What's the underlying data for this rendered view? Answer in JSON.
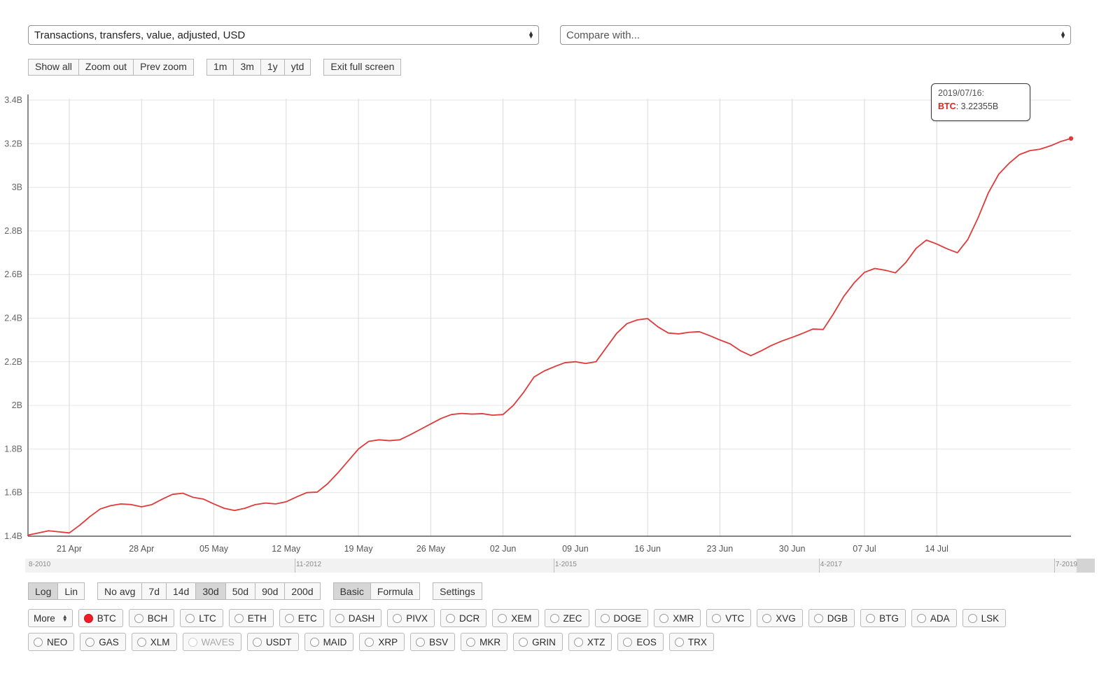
{
  "metric_select": {
    "value": "Transactions, transfers, value, adjusted, USD"
  },
  "compare_select": {
    "value": "Compare with..."
  },
  "range_buttons": {
    "zoom_group": [
      "Show all",
      "Zoom out",
      "Prev zoom"
    ],
    "period_group": [
      "1m",
      "3m",
      "1y",
      "ytd"
    ],
    "fullscreen": "Exit full screen"
  },
  "bottom_controls": {
    "scale_group": [
      "Log",
      "Lin"
    ],
    "scale_active": "Log",
    "avg_group": [
      "No avg",
      "7d",
      "14d",
      "30d",
      "50d",
      "90d",
      "200d"
    ],
    "avg_active": "30d",
    "mode_group": [
      "Basic",
      "Formula"
    ],
    "mode_active": "Basic",
    "settings": "Settings"
  },
  "coins": {
    "more_label": "More",
    "row1": [
      {
        "label": "BTC",
        "state": "on"
      },
      {
        "label": "BCH",
        "state": "off"
      },
      {
        "label": "LTC",
        "state": "off"
      },
      {
        "label": "ETH",
        "state": "off"
      },
      {
        "label": "ETC",
        "state": "off"
      },
      {
        "label": "DASH",
        "state": "off"
      },
      {
        "label": "PIVX",
        "state": "off"
      },
      {
        "label": "DCR",
        "state": "off"
      },
      {
        "label": "XEM",
        "state": "off"
      },
      {
        "label": "ZEC",
        "state": "off"
      },
      {
        "label": "DOGE",
        "state": "off"
      },
      {
        "label": "XMR",
        "state": "off"
      },
      {
        "label": "VTC",
        "state": "off"
      },
      {
        "label": "XVG",
        "state": "off"
      },
      {
        "label": "DGB",
        "state": "off"
      },
      {
        "label": "BTG",
        "state": "off"
      },
      {
        "label": "ADA",
        "state": "off"
      },
      {
        "label": "LSK",
        "state": "off"
      }
    ],
    "row2": [
      {
        "label": "NEO",
        "state": "off"
      },
      {
        "label": "GAS",
        "state": "off"
      },
      {
        "label": "XLM",
        "state": "off"
      },
      {
        "label": "WAVES",
        "state": "dim"
      },
      {
        "label": "USDT",
        "state": "off"
      },
      {
        "label": "MAID",
        "state": "off"
      },
      {
        "label": "XRP",
        "state": "off"
      },
      {
        "label": "BSV",
        "state": "off"
      },
      {
        "label": "MKR",
        "state": "off"
      },
      {
        "label": "GRIN",
        "state": "off"
      },
      {
        "label": "XTZ",
        "state": "off"
      },
      {
        "label": "EOS",
        "state": "off"
      },
      {
        "label": "TRX",
        "state": "off"
      }
    ]
  },
  "tooltip": {
    "date": "2019/07/16:",
    "symbol": "BTC",
    "value": ": 3.22355B"
  },
  "navigator": {
    "labels": [
      "8-2010",
      "11-2012",
      "1-2015",
      "4-2017",
      "7-2019"
    ],
    "label_positions_pct": [
      0.2,
      25.2,
      49.4,
      74.2,
      96.2
    ]
  },
  "chart_data": {
    "type": "line",
    "title": "Transactions, transfers, value, adjusted, USD",
    "xlabel": "",
    "ylabel": "",
    "series_name": "BTC",
    "series_color": "#e03a3a",
    "ylim": [
      1.4,
      3.4
    ],
    "y_ticks": [
      "1.4B",
      "1.6B",
      "1.8B",
      "2B",
      "2.2B",
      "2.4B",
      "2.6B",
      "2.8B",
      "3B",
      "3.2B",
      "3.4B"
    ],
    "y_tick_values": [
      1.4,
      1.6,
      1.8,
      2.0,
      2.2,
      2.4,
      2.6,
      2.8,
      3.0,
      3.2,
      3.4
    ],
    "x_ticks": [
      "21 Apr",
      "28 Apr",
      "05 May",
      "12 May",
      "19 May",
      "26 May",
      "02 Jun",
      "09 Jun",
      "16 Jun",
      "23 Jun",
      "30 Jun",
      "07 Jul",
      "14 Jul"
    ],
    "grid": true,
    "legend": "none",
    "units": "B (billions USD)",
    "x": [
      "2019-04-17",
      "2019-04-18",
      "2019-04-19",
      "2019-04-20",
      "2019-04-21",
      "2019-04-22",
      "2019-04-23",
      "2019-04-24",
      "2019-04-25",
      "2019-04-26",
      "2019-04-27",
      "2019-04-28",
      "2019-04-29",
      "2019-04-30",
      "2019-05-01",
      "2019-05-02",
      "2019-05-03",
      "2019-05-04",
      "2019-05-05",
      "2019-05-06",
      "2019-05-07",
      "2019-05-08",
      "2019-05-09",
      "2019-05-10",
      "2019-05-11",
      "2019-05-12",
      "2019-05-13",
      "2019-05-14",
      "2019-05-15",
      "2019-05-16",
      "2019-05-17",
      "2019-05-18",
      "2019-05-19",
      "2019-05-20",
      "2019-05-21",
      "2019-05-22",
      "2019-05-23",
      "2019-05-24",
      "2019-05-25",
      "2019-05-26",
      "2019-05-27",
      "2019-05-28",
      "2019-05-29",
      "2019-05-30",
      "2019-05-31",
      "2019-06-01",
      "2019-06-02",
      "2019-06-03",
      "2019-06-04",
      "2019-06-05",
      "2019-06-06",
      "2019-06-07",
      "2019-06-08",
      "2019-06-09",
      "2019-06-10",
      "2019-06-11",
      "2019-06-12",
      "2019-06-13",
      "2019-06-14",
      "2019-06-15",
      "2019-06-16",
      "2019-06-17",
      "2019-06-18",
      "2019-06-19",
      "2019-06-20",
      "2019-06-21",
      "2019-06-22",
      "2019-06-23",
      "2019-06-24",
      "2019-06-25",
      "2019-06-26",
      "2019-06-27",
      "2019-06-28",
      "2019-06-29",
      "2019-06-30",
      "2019-07-01",
      "2019-07-02",
      "2019-07-03",
      "2019-07-04",
      "2019-07-05",
      "2019-07-06",
      "2019-07-07",
      "2019-07-08",
      "2019-07-09",
      "2019-07-10",
      "2019-07-11",
      "2019-07-12",
      "2019-07-13",
      "2019-07-14",
      "2019-07-15",
      "2019-07-16"
    ],
    "values": [
      1.405,
      1.415,
      1.425,
      1.42,
      1.415,
      1.45,
      1.49,
      1.525,
      1.54,
      1.548,
      1.545,
      1.535,
      1.545,
      1.57,
      1.592,
      1.597,
      1.578,
      1.57,
      1.548,
      1.528,
      1.518,
      1.528,
      1.545,
      1.552,
      1.548,
      1.558,
      1.58,
      1.6,
      1.602,
      1.64,
      1.69,
      1.745,
      1.8,
      1.835,
      1.842,
      1.838,
      1.842,
      1.865,
      1.89,
      1.915,
      1.94,
      1.958,
      1.963,
      1.96,
      1.962,
      1.955,
      1.958,
      2.0,
      2.06,
      2.13,
      2.158,
      2.178,
      2.196,
      2.2,
      2.192,
      2.2,
      2.265,
      2.33,
      2.375,
      2.392,
      2.398,
      2.36,
      2.332,
      2.328,
      2.335,
      2.338,
      2.32,
      2.3,
      2.282,
      2.25,
      2.228,
      2.25,
      2.275,
      2.295,
      2.312,
      2.33,
      2.35,
      2.348,
      2.42,
      2.5,
      2.562,
      2.61,
      2.628,
      2.62,
      2.608,
      2.655,
      2.72,
      2.758,
      2.74,
      2.718,
      2.7
    ],
    "values_tail": [
      2.76,
      2.86,
      2.975,
      3.06,
      3.11,
      3.15,
      3.168,
      3.175,
      3.19,
      3.21,
      3.224
    ],
    "annotation": {
      "date": "2019/07/16",
      "series": "BTC",
      "value": "3.22355B"
    }
  }
}
